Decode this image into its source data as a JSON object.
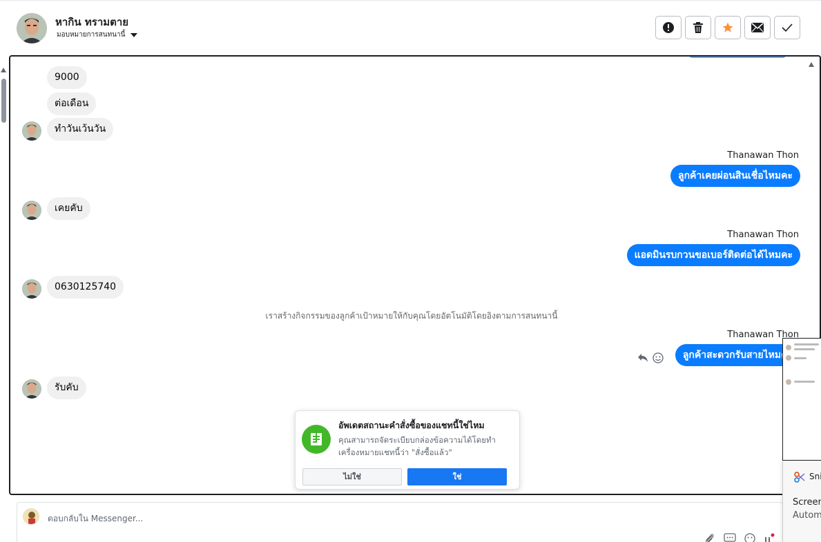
{
  "header": {
    "contact_name": "หากิน ทรามตาย",
    "assignment_label": "มอบหมายการสนทนานี้",
    "actions": [
      {
        "name": "mark-spam-button",
        "icon": "alert-icon"
      },
      {
        "name": "delete-button",
        "icon": "trash-icon"
      },
      {
        "name": "star-button",
        "icon": "star-icon"
      },
      {
        "name": "mark-unread-button",
        "icon": "envelope-icon"
      },
      {
        "name": "mark-done-button",
        "icon": "check-icon"
      }
    ]
  },
  "messages": {
    "in_1": "9000",
    "in_2": "ต่อเดือน",
    "in_3": "ทำวันเว้นวัน",
    "sender_1": "Thanawan Thon",
    "out_1": "ลูกค้าเคยผ่อนสินเชื่อไหมคะ",
    "in_4": "เคยคับ",
    "sender_2": "Thanawan Thon",
    "out_2": "แอดมินรบกวนขอเบอร์ติดต่อได้ไหมคะ",
    "in_5": "0630125740",
    "system_note": "เราสร้างกิจกรรมของลูกค้าเป้าหมายให้กับคุณโดยอัตโนมัติโดยอิงตามการสนทนานี้",
    "sender_3": "Thanawan Thon",
    "out_3": "ลูกค้าสะดวกรับสายไหมคะ",
    "in_6": "รับคับ"
  },
  "popup": {
    "title": "อัพเดตสถานะคำสั่งซื้อของแชทนี้ใช่ไหม",
    "body": "คุณสามารถจัดระเบียบกล่องข้อความได้โดยทำเครื่องหมายแชทนี้ว่า \"สั่งซื้อแล้ว\"",
    "no_label": "ไม่ใช่",
    "yes_label": "ใช่"
  },
  "composer": {
    "placeholder": "ตอบกลับใน Messenger..."
  },
  "overlay": {
    "snip_title": "Sni",
    "snip_line1": "Screen",
    "snip_line2": "Autom"
  },
  "colors": {
    "accent_blue": "#0a7cff",
    "button_blue": "#1877f2",
    "star_orange": "#f7923a",
    "popup_green": "#42b72a",
    "bubble_gray": "#f0f0f0"
  }
}
